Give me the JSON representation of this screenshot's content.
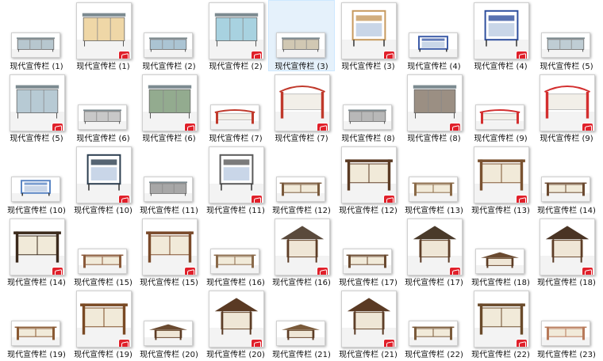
{
  "items": [
    {
      "label": "现代宣传栏 (1)",
      "size": "small",
      "style": "glass",
      "color": "#9fb4bf"
    },
    {
      "label": "现代宣传栏 (1)",
      "size": "large",
      "style": "glass",
      "color": "#e9c98a"
    },
    {
      "label": "现代宣传栏 (2)",
      "size": "small",
      "style": "glass",
      "color": "#8fb0c4"
    },
    {
      "label": "现代宣传栏 (2)",
      "size": "large",
      "style": "glass",
      "color": "#8bc3d6"
    },
    {
      "label": "现代宣传栏 (3)",
      "size": "small",
      "style": "glass",
      "color": "#c2b59a",
      "selected": true
    },
    {
      "label": "现代宣传栏 (3)",
      "size": "large",
      "style": "board",
      "color": "#c79a5e"
    },
    {
      "label": "现代宣传栏 (4)",
      "size": "small",
      "style": "board",
      "color": "#3d5ca8"
    },
    {
      "label": "现代宣传栏 (4)",
      "size": "large",
      "style": "board",
      "color": "#2f4f9e"
    },
    {
      "label": "现代宣传栏 (5)",
      "size": "small",
      "style": "glass",
      "color": "#a9bcc6"
    },
    {
      "label": "现代宣传栏 (5)",
      "size": "large",
      "style": "glass",
      "color": "#9fb8c6"
    },
    {
      "label": "现代宣传栏 (6)",
      "size": "small",
      "style": "glass",
      "color": "#b6b6b6"
    },
    {
      "label": "现代宣传栏 (6)",
      "size": "large",
      "style": "glass",
      "color": "#6f8f6a"
    },
    {
      "label": "现代宣传栏 (7)",
      "size": "small",
      "style": "red",
      "color": "#c0392b"
    },
    {
      "label": "现代宣传栏 (7)",
      "size": "large",
      "style": "red",
      "color": "#c0392b"
    },
    {
      "label": "现代宣传栏 (8)",
      "size": "small",
      "style": "glass",
      "color": "#a0a0a0"
    },
    {
      "label": "现代宣传栏 (8)",
      "size": "large",
      "style": "glass",
      "color": "#7a6a5a"
    },
    {
      "label": "现代宣传栏 (9)",
      "size": "small",
      "style": "red",
      "color": "#d32f2f"
    },
    {
      "label": "现代宣传栏 (9)",
      "size": "large",
      "style": "red",
      "color": "#d32f2f"
    },
    {
      "label": "现代宣传栏 (10)",
      "size": "small",
      "style": "board",
      "color": "#5b86c4"
    },
    {
      "label": "现代宣传栏 (10)",
      "size": "large",
      "style": "board",
      "color": "#2c3e50"
    },
    {
      "label": "现代宣传栏 (11)",
      "size": "small",
      "style": "glass",
      "color": "#8a8a8a"
    },
    {
      "label": "现代宣传栏 (11)",
      "size": "large",
      "style": "board",
      "color": "#5a5a5a"
    },
    {
      "label": "现代宣传栏 (12)",
      "size": "small",
      "style": "wood",
      "color": "#7a5a3c"
    },
    {
      "label": "现代宣传栏 (12)",
      "size": "large",
      "style": "wood",
      "color": "#5b3b24"
    },
    {
      "label": "现代宣传栏 (13)",
      "size": "small",
      "style": "wood",
      "color": "#8a6a48"
    },
    {
      "label": "现代宣传栏 (13)",
      "size": "large",
      "style": "wood",
      "color": "#7a5230"
    },
    {
      "label": "现代宣传栏 (14)",
      "size": "small",
      "style": "wood",
      "color": "#6b4a30"
    },
    {
      "label": "现代宣传栏 (14)",
      "size": "large",
      "style": "wood",
      "color": "#3b2a1c"
    },
    {
      "label": "现代宣传栏 (15)",
      "size": "small",
      "style": "wood",
      "color": "#8a5a3a"
    },
    {
      "label": "现代宣传栏 (15)",
      "size": "large",
      "style": "wood",
      "color": "#7a4a2a"
    },
    {
      "label": "现代宣传栏 (16)",
      "size": "small",
      "style": "wood",
      "color": "#8a6a4a"
    },
    {
      "label": "现代宣传栏 (16)",
      "size": "large",
      "style": "roof",
      "color": "#5a4a3c"
    },
    {
      "label": "现代宣传栏 (17)",
      "size": "small",
      "style": "wood",
      "color": "#6a4a30"
    },
    {
      "label": "现代宣传栏 (17)",
      "size": "large",
      "style": "roof",
      "color": "#4a3a2a"
    },
    {
      "label": "现代宣传栏 (18)",
      "size": "small",
      "style": "roof",
      "color": "#6a4a30"
    },
    {
      "label": "现代宣传栏 (18)",
      "size": "large",
      "style": "roof",
      "color": "#4a3424"
    },
    {
      "label": "现代宣传栏 (19)",
      "size": "small",
      "style": "wood",
      "color": "#8a5a34"
    },
    {
      "label": "现代宣传栏 (19)",
      "size": "large",
      "style": "wood",
      "color": "#7a4a24"
    },
    {
      "label": "现代宣传栏 (20)",
      "size": "small",
      "style": "roof",
      "color": "#6a4a30"
    },
    {
      "label": "现代宣传栏 (20)",
      "size": "large",
      "style": "roof",
      "color": "#5a3a24"
    },
    {
      "label": "现代宣传栏 (21)",
      "size": "small",
      "style": "roof",
      "color": "#7a5a3a"
    },
    {
      "label": "现代宣传栏 (21)",
      "size": "large",
      "style": "roof",
      "color": "#5a3a24"
    },
    {
      "label": "现代宣传栏 (22)",
      "size": "small",
      "style": "wood",
      "color": "#7a5a3a"
    },
    {
      "label": "现代宣传栏 (22)",
      "size": "large",
      "style": "wood",
      "color": "#6a4a2a"
    },
    {
      "label": "现代宣传栏 (23)",
      "size": "small",
      "style": "wood",
      "color": "#b87a5a"
    }
  ],
  "icon": {
    "name": "sketchup-file-icon",
    "color": "#e0202a"
  }
}
